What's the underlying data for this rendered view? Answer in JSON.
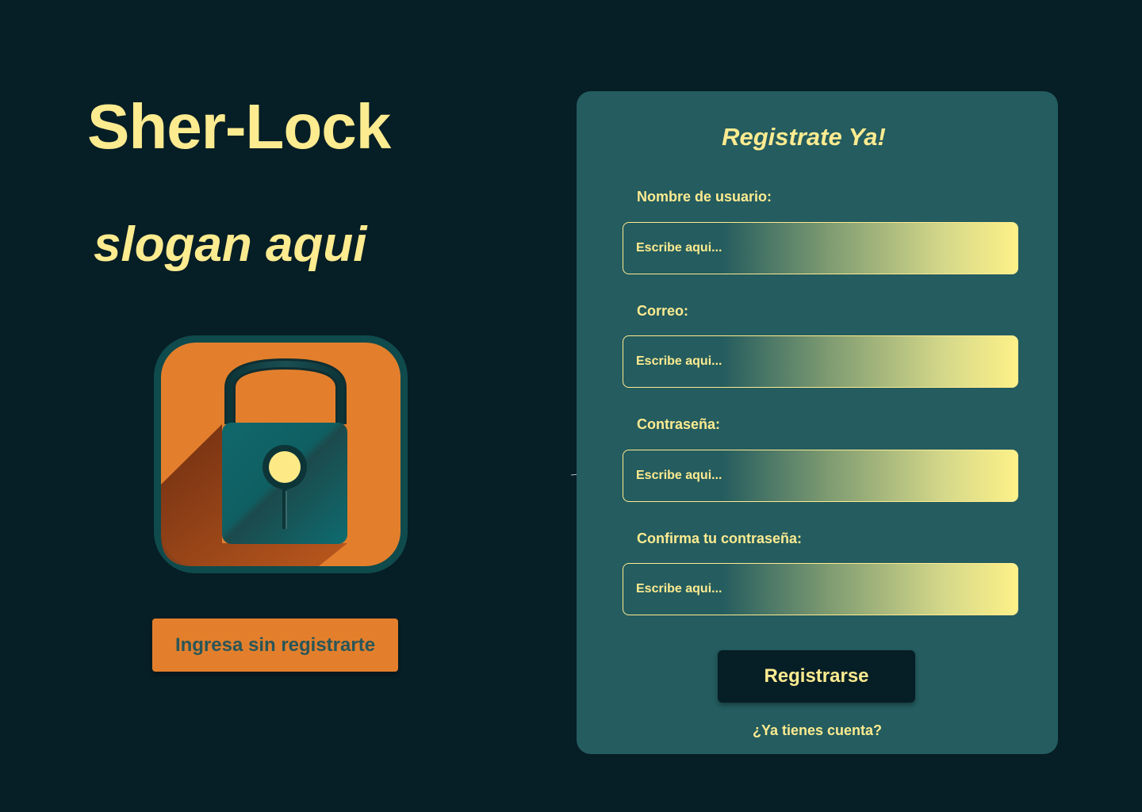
{
  "brand": {
    "title": "Sher-Lock",
    "slogan": "slogan aqui",
    "logo_icon": "padlock-magnifier-icon"
  },
  "guest_button": {
    "label": "Ingresa sin registrarte"
  },
  "register": {
    "title": "Registrate Ya!",
    "fields": [
      {
        "label": "Nombre de usuario:",
        "placeholder": "Escribe aqui..."
      },
      {
        "label": "Correo:",
        "placeholder": "Escribe aqui..."
      },
      {
        "label": "Contraseña:",
        "placeholder": "Escribe aqui..."
      },
      {
        "label": "Confirma tu contraseña:",
        "placeholder": "Escribe aqui..."
      }
    ],
    "submit_label": "Registrarse",
    "login_link": "¿Ya tienes cuenta?"
  },
  "colors": {
    "background": "#061e25",
    "card": "#245c5f",
    "accent_yellow": "#fdeb90",
    "accent_orange": "#e37f2c"
  }
}
